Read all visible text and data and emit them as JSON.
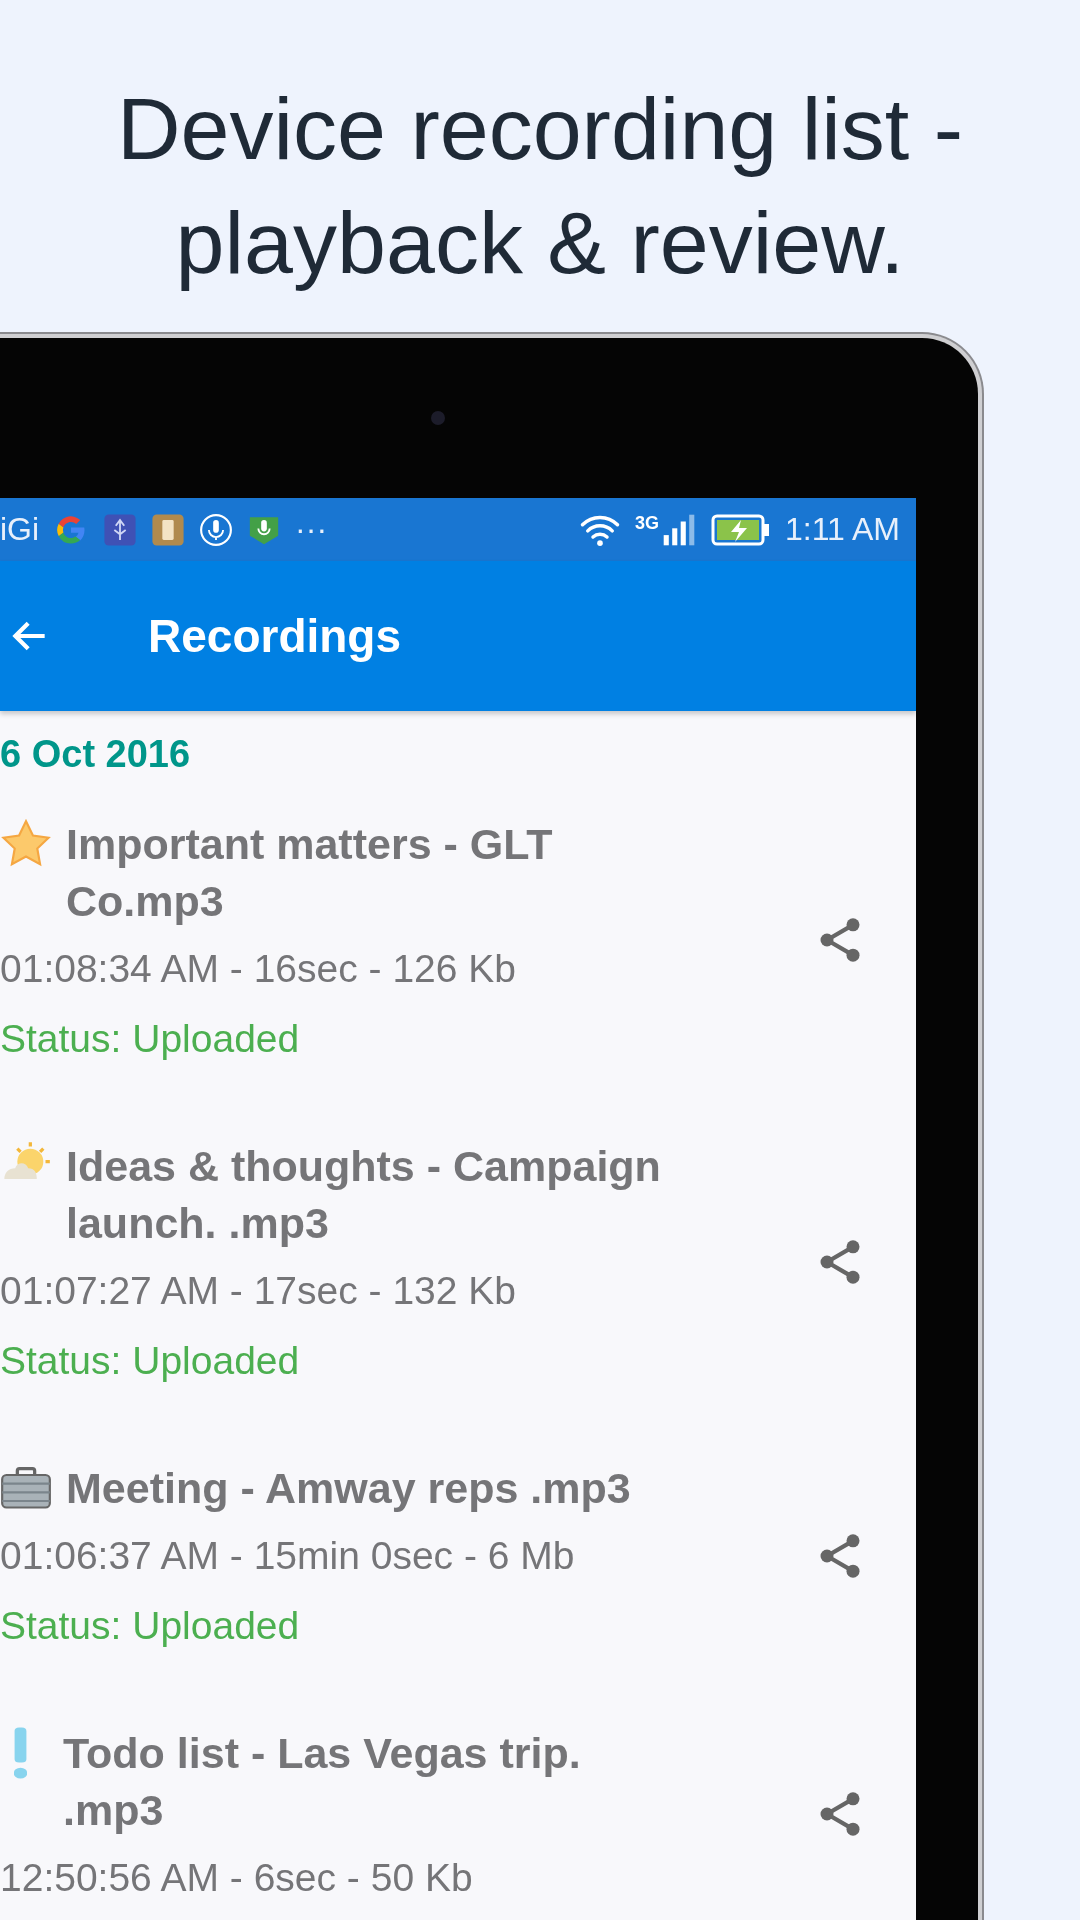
{
  "headline": "Device recording list - playback & review.",
  "status_bar": {
    "carrier": "iGi",
    "more": "···",
    "network": "3G",
    "time": "1:11 AM"
  },
  "toolbar": {
    "title": "Recordings"
  },
  "date_header": "6 Oct 2016",
  "recordings": [
    {
      "kind": "star",
      "title": "Important matters - GLT Co.mp3",
      "meta": "01:08:34 AM - 16sec - 126 Kb",
      "status": "Status: Uploaded"
    },
    {
      "kind": "idea",
      "title": "Ideas & thoughts - Campaign launch. .mp3",
      "meta": "01:07:27 AM - 17sec - 132 Kb",
      "status": "Status: Uploaded"
    },
    {
      "kind": "briefcase",
      "title": "Meeting - Amway reps .mp3",
      "meta": "01:06:37 AM - 15min 0sec - 6 Mb",
      "status": "Status: Uploaded"
    },
    {
      "kind": "alert",
      "title": "Todo list - Las Vegas trip. .mp3",
      "meta": "12:50:56 AM - 6sec - 50 Kb"
    }
  ]
}
